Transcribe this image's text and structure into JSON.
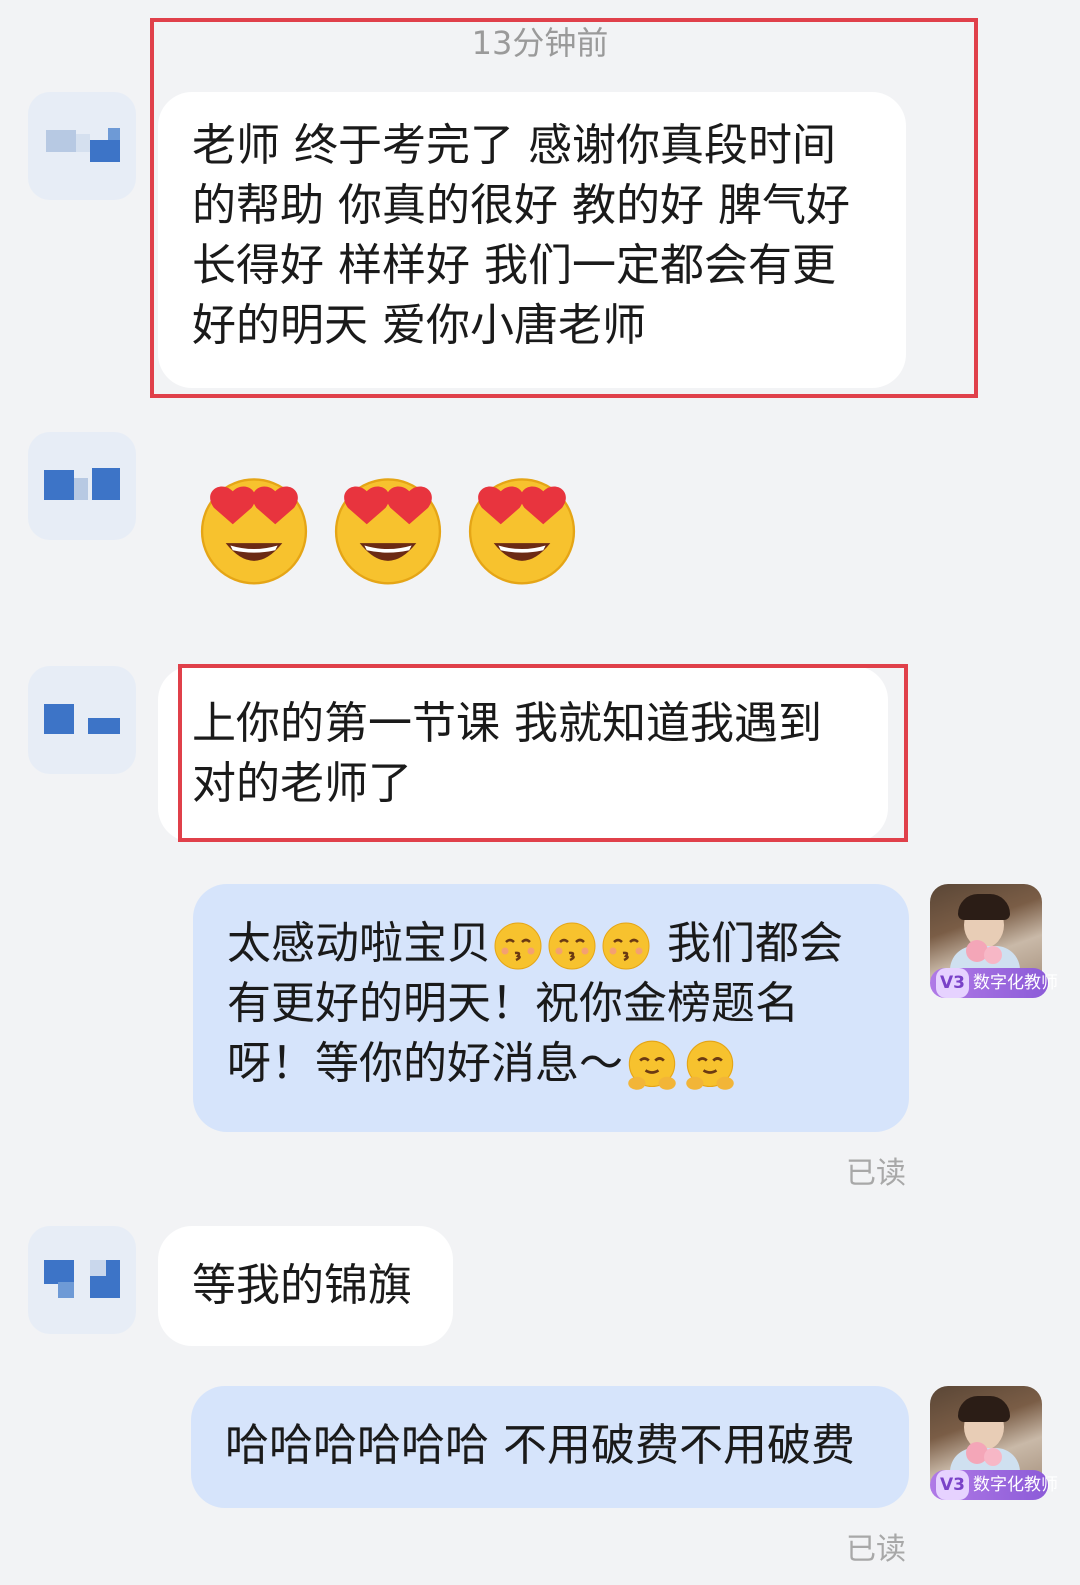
{
  "timestamp": "13分钟前",
  "messages": {
    "m1": "老师 终于考完了 感谢你真段时间的帮助 你真的很好 教的好 脾气好 长得好 样样好  我们一定都会有更好的明天 爱你小唐老师",
    "m3": "上你的第一节课 我就知道我遇到对的老师了",
    "m4": {
      "part1": "太感动啦宝贝",
      "part2": "我们都会有更好的明天！祝你金榜题名呀！等你的好消息～"
    },
    "m5": "等我的锦旗",
    "m6": "哈哈哈哈哈哈 不用破费不用破费"
  },
  "read_status": "已读",
  "badge": {
    "level": "V3",
    "label": "数字化教师"
  },
  "icons": {
    "heart_eyes": "heart-eyes-emoji",
    "kissing": "kissing-emoji",
    "hugging": "hugging-face-emoji"
  },
  "colors": {
    "background": "#f2f3f5",
    "incoming_bubble": "#ffffff",
    "outgoing_bubble": "#d6e4fb",
    "highlight_box": "#e0404a"
  }
}
